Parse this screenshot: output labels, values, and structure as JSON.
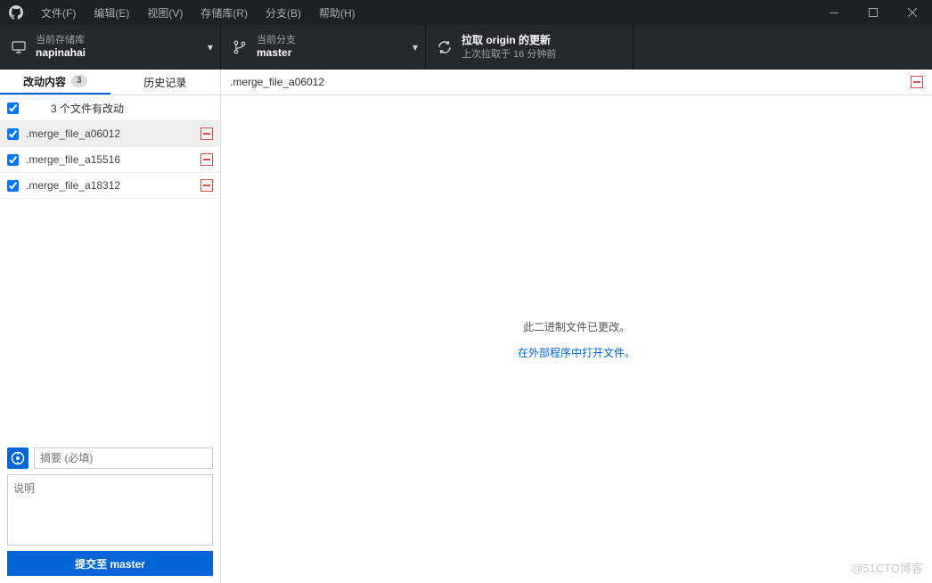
{
  "menu": {
    "file": "文件(F)",
    "edit": "编辑(E)",
    "view": "视图(V)",
    "repo": "存储库(R)",
    "branch": "分支(B)",
    "help": "帮助(H)"
  },
  "toolbar": {
    "repo": {
      "label": "当前存储库",
      "value": "napinahai"
    },
    "branch": {
      "label": "当前分支",
      "value": "master"
    },
    "fetch": {
      "label": "拉取 origin 的更新",
      "sublabel": "上次拉取于 16 分钟前"
    }
  },
  "tabs": {
    "changes": "改动内容",
    "count": "3",
    "history": "历史记录"
  },
  "changes_summary": "3 个文件有改动",
  "files": [
    {
      "name": ".merge_file_a06012"
    },
    {
      "name": ".merge_file_a15516"
    },
    {
      "name": ".merge_file_a18312"
    }
  ],
  "commit": {
    "summary_placeholder": "摘要 (必填)",
    "description_placeholder": "说明",
    "button": "提交至 master"
  },
  "diff": {
    "filename": ".merge_file_a06012",
    "binary_msg": "此二进制文件已更改。",
    "open_link": "在外部程序中打开文件。"
  },
  "watermark": "@51CTO博客"
}
